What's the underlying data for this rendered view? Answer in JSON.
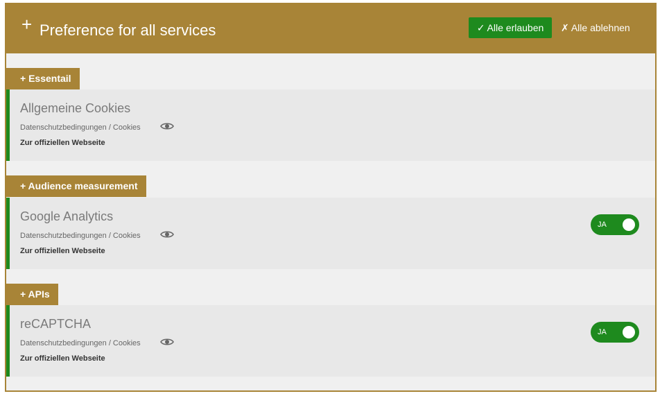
{
  "header": {
    "plus_icon": "+",
    "title": "Preference for all services",
    "accept_all": "✓ Alle erlauben",
    "deny_all": "✗ Alle ablehnen"
  },
  "categories": [
    {
      "label": "+ Essentail",
      "services": [
        {
          "name": "Allgemeine Cookies",
          "policy": "Datenschutzbedingungen / Cookies",
          "website": "Zur offiziellen Webseite",
          "toggle": null
        }
      ]
    },
    {
      "label": "+ Audience measurement",
      "services": [
        {
          "name": "Google Analytics",
          "policy": "Datenschutzbedingungen / Cookies",
          "website": "Zur offiziellen Webseite",
          "toggle": "JA"
        }
      ]
    },
    {
      "label": "+ APIs",
      "services": [
        {
          "name": "reCAPTCHA",
          "policy": "Datenschutzbedingungen / Cookies",
          "website": "Zur offiziellen Webseite",
          "toggle": "JA"
        }
      ]
    }
  ],
  "colors": {
    "brand": "#a88437",
    "accent_green": "#1e8a1e",
    "panel_bg": "#f0f0f0",
    "service_bg": "#e8e8e8"
  },
  "icons": {
    "view": "eye-icon"
  }
}
